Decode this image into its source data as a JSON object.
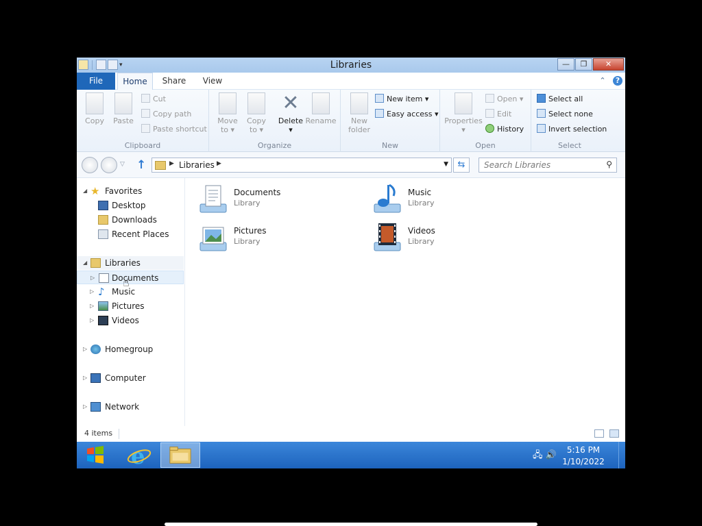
{
  "window": {
    "title": "Libraries",
    "controls": {
      "minimize": "—",
      "maximize": "❐",
      "close": "✕"
    }
  },
  "tabs": {
    "file": "File",
    "home": "Home",
    "share": "Share",
    "view": "View"
  },
  "ribbon": {
    "clipboard": {
      "label": "Clipboard",
      "copy": "Copy",
      "paste": "Paste",
      "cut": "Cut",
      "copy_path": "Copy path",
      "paste_shortcut": "Paste shortcut"
    },
    "organize": {
      "label": "Organize",
      "move_to_1": "Move",
      "move_to_2": "to ▾",
      "copy_to_1": "Copy",
      "copy_to_2": "to ▾",
      "delete": "Delete",
      "delete_arrow": "▾",
      "rename": "Rename"
    },
    "new": {
      "label": "New",
      "new_folder_1": "New",
      "new_folder_2": "folder",
      "new_item": "New item ▾",
      "easy_access": "Easy access ▾"
    },
    "open": {
      "label": "Open",
      "properties": "Properties",
      "properties_arrow": "▾",
      "open": "Open ▾",
      "edit": "Edit",
      "history": "History"
    },
    "select": {
      "label": "Select",
      "select_all": "Select all",
      "select_none": "Select none",
      "invert": "Invert selection"
    }
  },
  "address": {
    "path": "Libraries",
    "search_placeholder": "Search Libraries"
  },
  "nav": {
    "favorites": "Favorites",
    "desktop": "Desktop",
    "downloads": "Downloads",
    "recent": "Recent Places",
    "libraries": "Libraries",
    "documents": "Documents",
    "music": "Music",
    "pictures": "Pictures",
    "videos": "Videos",
    "homegroup": "Homegroup",
    "computer": "Computer",
    "network": "Network"
  },
  "libraries": [
    {
      "name": "Documents",
      "type": "Library"
    },
    {
      "name": "Music",
      "type": "Library"
    },
    {
      "name": "Pictures",
      "type": "Library"
    },
    {
      "name": "Videos",
      "type": "Library"
    }
  ],
  "status": {
    "count": "4 items"
  },
  "taskbar": {
    "time": "5:16 PM",
    "date": "1/10/2022"
  },
  "colors": {
    "file_tab": "#1f67b9",
    "taskbar": "#2a74cc",
    "selection": "#e5f0fb"
  }
}
